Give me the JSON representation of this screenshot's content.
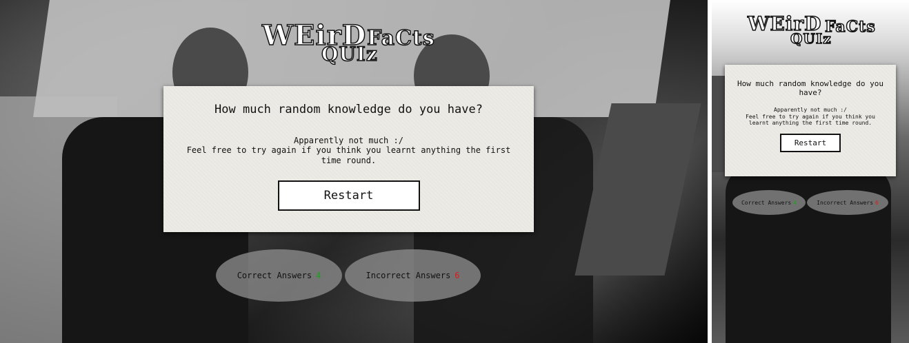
{
  "logo": {
    "line1": "WEirD",
    "line2": "FaCts",
    "line3": "QUIz"
  },
  "quiz": {
    "question": "How much random knowledge do you have?",
    "message_line1": "Apparently not much :/",
    "message_line2": "Feel free to try again if you think you learnt anything the first time round.",
    "restart_label": "Restart"
  },
  "score": {
    "correct_label": "Correct Answers",
    "correct_value": "4",
    "incorrect_label": "Incorrect Answers",
    "incorrect_value": "6"
  },
  "colors": {
    "correct": "#1aa21a",
    "incorrect": "#e01818",
    "card": "#ecebe5"
  }
}
